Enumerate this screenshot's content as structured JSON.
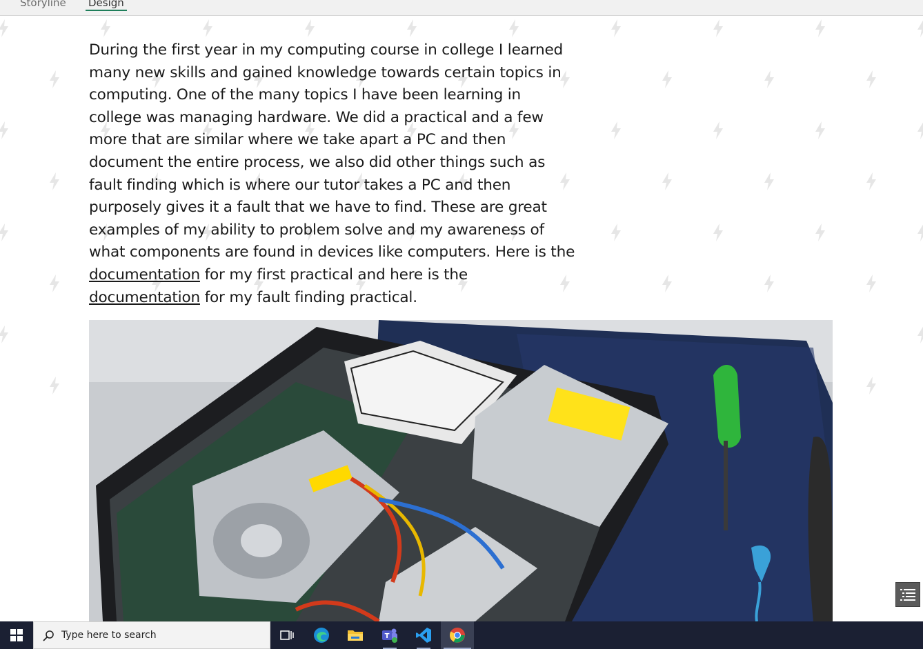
{
  "tabs": [
    {
      "label": "Storyline"
    },
    {
      "label": "Design",
      "selected": true
    }
  ],
  "story": {
    "lines": [
      "During the first year in my computing course in college I learned",
      "many new skills and gained knowledge towards certain topics in",
      "computing. One of the many topics I have been learning in",
      "college was managing hardware. We did a practical and a few",
      "more that are similar where we take apart a PC and then",
      "document the entire process, we also did other things such as",
      "fault finding which is where our tutor takes a PC and then",
      "purposely gives it a fault that we have to find. These are great",
      "examples of my ability to problem solve and my awareness of",
      "what components are found in devices like computers. Here is the"
    ],
    "link_line_1": {
      "link": "documentation",
      "rest": " for my first practical and here is the"
    },
    "link_line_2": {
      "link": "documentation",
      "rest": " for my fault finding practical."
    }
  },
  "photo": {
    "icon": "pc-internals-photo"
  },
  "nav_button": {
    "icon": "list-navigation-icon"
  },
  "taskbar": {
    "search_placeholder": "Type here to search",
    "apps": [
      {
        "name": "task-view-icon"
      },
      {
        "name": "edge-icon"
      },
      {
        "name": "file-explorer-icon"
      },
      {
        "name": "teams-icon"
      },
      {
        "name": "vscode-icon"
      },
      {
        "name": "chrome-icon",
        "active": true
      }
    ]
  },
  "colors": {
    "tab_underline": "#1e7e5a",
    "taskbar": "#1b2033",
    "text": "#1a1a1a"
  }
}
